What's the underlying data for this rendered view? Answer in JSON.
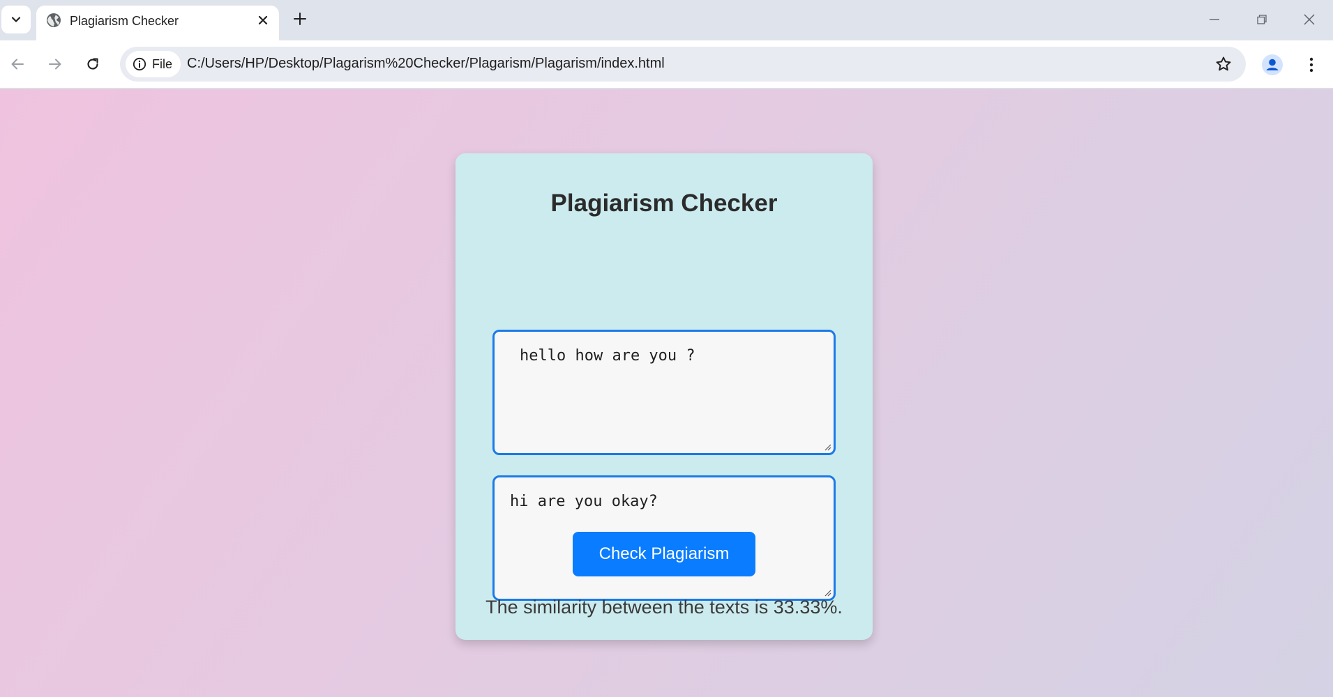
{
  "browser": {
    "tab": {
      "title": "Plagiarism Checker",
      "favicon": "globe-icon"
    },
    "omnibox": {
      "chip_label": "File",
      "url": "C:/Users/HP/Desktop/Plagarism%20Checker/Plagarism/Plagarism/index.html"
    },
    "icons": {
      "tab_search": "chevron-down-icon",
      "tab_close": "close-icon",
      "new_tab": "plus-icon",
      "minimize": "minimize-icon",
      "restore": "restore-icon",
      "close_window": "close-icon",
      "back": "back-arrow-icon",
      "forward": "forward-arrow-icon",
      "reload": "reload-icon",
      "info": "info-icon",
      "bookmark": "star-icon",
      "profile": "profile-icon",
      "menu": "kebab-menu-icon"
    }
  },
  "page": {
    "title": "Plagiarism Checker",
    "text1": "hello how are you ?",
    "text2": "hi are you okay?",
    "button_label": "Check Plagiarism",
    "result": "The similarity between the texts is 33.33%."
  },
  "colors": {
    "accent": "#0a7cff",
    "card_bg": "#ccebee",
    "textarea_border": "#1a7ae8",
    "gradient_start": "#efc3df",
    "gradient_end": "#d4d2e4"
  }
}
